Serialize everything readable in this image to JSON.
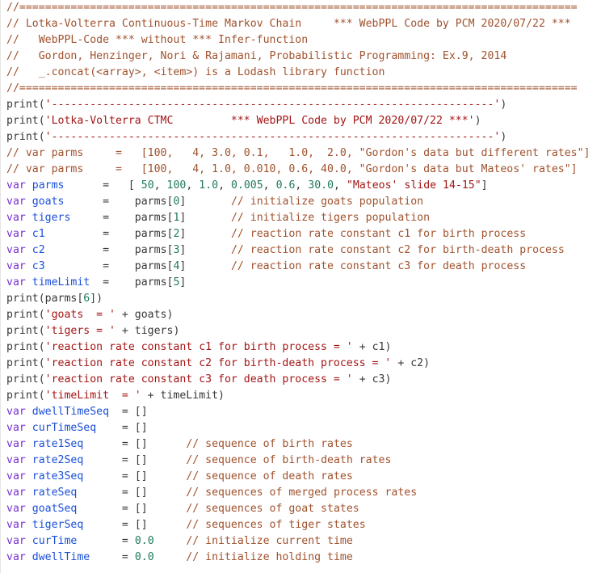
{
  "editor": {
    "lines": [
      [
        [
          "comment",
          "//======================================================================================="
        ]
      ],
      [
        [
          "comment",
          "// Lotka-Volterra Continuous-Time Markov Chain     *** WebPPL Code by PCM 2020/07/22 ***"
        ]
      ],
      [
        [
          "comment",
          "//   WebPPL-Code *** without *** Infer-function"
        ]
      ],
      [
        [
          "comment",
          "//   Gordon, Henzinger, Nori & Rajamani, Probabilistic Programming: Ex.9, 2014"
        ]
      ],
      [
        [
          "comment",
          "//   _.concat(<array>, <item>) is a Lodash library function"
        ]
      ],
      [
        [
          "comment",
          "//======================================================================================="
        ]
      ],
      [
        [
          "plain",
          "print("
        ],
        [
          "string",
          "'---------------------------------------------------------------------'"
        ],
        [
          "plain",
          ")"
        ]
      ],
      [
        [
          "plain",
          "print("
        ],
        [
          "string",
          "'Lotka-Volterra CTMC         *** WebPPL Code by PCM 2020/07/22 ***'"
        ],
        [
          "plain",
          ")"
        ]
      ],
      [
        [
          "plain",
          "print("
        ],
        [
          "string",
          "'---------------------------------------------------------------------'"
        ],
        [
          "plain",
          ")"
        ]
      ],
      [
        [
          "comment",
          "// var parms     =   [100,   4, 3.0, 0.1,   1.0,  2.0, \"Gordon's data but different rates\"]"
        ]
      ],
      [
        [
          "comment",
          "// var parms     =   [100,   4, 1.0, 0.010, 0.6, 40.0, \"Gordon's data but Mateos' rates\"]"
        ]
      ],
      [
        [
          "keyword",
          "var "
        ],
        [
          "variable",
          "parms"
        ],
        [
          "plain",
          "      =   [ "
        ],
        [
          "number",
          "50"
        ],
        [
          "plain",
          ", "
        ],
        [
          "number",
          "100"
        ],
        [
          "plain",
          ", "
        ],
        [
          "number",
          "1.0"
        ],
        [
          "plain",
          ", "
        ],
        [
          "number",
          "0.005"
        ],
        [
          "plain",
          ", "
        ],
        [
          "number",
          "0.6"
        ],
        [
          "plain",
          ", "
        ],
        [
          "number",
          "30.0"
        ],
        [
          "plain",
          ", "
        ],
        [
          "string",
          "\"Mateos' slide 14-15\""
        ],
        [
          "plain",
          "]"
        ]
      ],
      [
        [
          "keyword",
          "var "
        ],
        [
          "variable",
          "goats"
        ],
        [
          "plain",
          "      =    parms["
        ],
        [
          "number",
          "0"
        ],
        [
          "plain",
          "]       "
        ],
        [
          "comment",
          "// initialize goats population"
        ]
      ],
      [
        [
          "keyword",
          "var "
        ],
        [
          "variable",
          "tigers"
        ],
        [
          "plain",
          "     =    parms["
        ],
        [
          "number",
          "1"
        ],
        [
          "plain",
          "]       "
        ],
        [
          "comment",
          "// initialize tigers population"
        ]
      ],
      [
        [
          "keyword",
          "var "
        ],
        [
          "variable",
          "c1"
        ],
        [
          "plain",
          "         =    parms["
        ],
        [
          "number",
          "2"
        ],
        [
          "plain",
          "]       "
        ],
        [
          "comment",
          "// reaction rate constant c1 for birth process"
        ]
      ],
      [
        [
          "keyword",
          "var "
        ],
        [
          "variable",
          "c2"
        ],
        [
          "plain",
          "         =    parms["
        ],
        [
          "number",
          "3"
        ],
        [
          "plain",
          "]       "
        ],
        [
          "comment",
          "// reaction rate constant c2 for birth-death process"
        ]
      ],
      [
        [
          "keyword",
          "var "
        ],
        [
          "variable",
          "c3"
        ],
        [
          "plain",
          "         =    parms["
        ],
        [
          "number",
          "4"
        ],
        [
          "plain",
          "]       "
        ],
        [
          "comment",
          "// reaction rate constant c3 for death process"
        ]
      ],
      [
        [
          "keyword",
          "var "
        ],
        [
          "variable",
          "timeLimit"
        ],
        [
          "plain",
          "  =    parms["
        ],
        [
          "number",
          "5"
        ],
        [
          "plain",
          "]"
        ]
      ],
      [
        [
          "plain",
          "print(parms["
        ],
        [
          "number",
          "6"
        ],
        [
          "plain",
          "])"
        ]
      ],
      [
        [
          "plain",
          "print("
        ],
        [
          "string",
          "'goats  = '"
        ],
        [
          "plain",
          " + goats)"
        ]
      ],
      [
        [
          "plain",
          "print("
        ],
        [
          "string",
          "'tigers = '"
        ],
        [
          "plain",
          " + tigers)"
        ]
      ],
      [
        [
          "plain",
          "print("
        ],
        [
          "string",
          "'reaction rate constant c1 for birth process = '"
        ],
        [
          "plain",
          " + c1)"
        ]
      ],
      [
        [
          "plain",
          "print("
        ],
        [
          "string",
          "'reaction rate constant c2 for birth-death process = '"
        ],
        [
          "plain",
          " + c2)"
        ]
      ],
      [
        [
          "plain",
          "print("
        ],
        [
          "string",
          "'reaction rate constant c3 for death process = '"
        ],
        [
          "plain",
          " + c3)"
        ]
      ],
      [
        [
          "plain",
          "print("
        ],
        [
          "string",
          "'timeLimit  = '"
        ],
        [
          "plain",
          " + timeLimit)"
        ]
      ],
      [
        [
          "keyword",
          "var "
        ],
        [
          "variable",
          "dwellTimeSeq"
        ],
        [
          "plain",
          "  = []"
        ]
      ],
      [
        [
          "keyword",
          "var "
        ],
        [
          "variable",
          "curTimeSeq"
        ],
        [
          "plain",
          "    = []"
        ]
      ],
      [
        [
          "keyword",
          "var "
        ],
        [
          "variable",
          "rate1Seq"
        ],
        [
          "plain",
          "      = []      "
        ],
        [
          "comment",
          "// sequence of birth rates"
        ]
      ],
      [
        [
          "keyword",
          "var "
        ],
        [
          "variable",
          "rate2Seq"
        ],
        [
          "plain",
          "      = []      "
        ],
        [
          "comment",
          "// sequence of birth-death rates"
        ]
      ],
      [
        [
          "keyword",
          "var "
        ],
        [
          "variable",
          "rate3Seq"
        ],
        [
          "plain",
          "      = []      "
        ],
        [
          "comment",
          "// sequence of death rates"
        ]
      ],
      [
        [
          "keyword",
          "var "
        ],
        [
          "variable",
          "rateSeq"
        ],
        [
          "plain",
          "       = []      "
        ],
        [
          "comment",
          "// sequences of merged process rates"
        ]
      ],
      [
        [
          "keyword",
          "var "
        ],
        [
          "variable",
          "goatSeq"
        ],
        [
          "plain",
          "       = []      "
        ],
        [
          "comment",
          "// sequences of goat states"
        ]
      ],
      [
        [
          "keyword",
          "var "
        ],
        [
          "variable",
          "tigerSeq"
        ],
        [
          "plain",
          "      = []      "
        ],
        [
          "comment",
          "// sequences of tiger states"
        ]
      ],
      [
        [
          "keyword",
          "var "
        ],
        [
          "variable",
          "curTime"
        ],
        [
          "plain",
          "       = "
        ],
        [
          "number",
          "0.0"
        ],
        [
          "plain",
          "     "
        ],
        [
          "comment",
          "// initialize current time"
        ]
      ],
      [
        [
          "keyword",
          "var "
        ],
        [
          "variable",
          "dwellTime"
        ],
        [
          "plain",
          "     = "
        ],
        [
          "number",
          "0.0"
        ],
        [
          "plain",
          "     "
        ],
        [
          "comment",
          "// initialize holding time"
        ]
      ]
    ]
  }
}
